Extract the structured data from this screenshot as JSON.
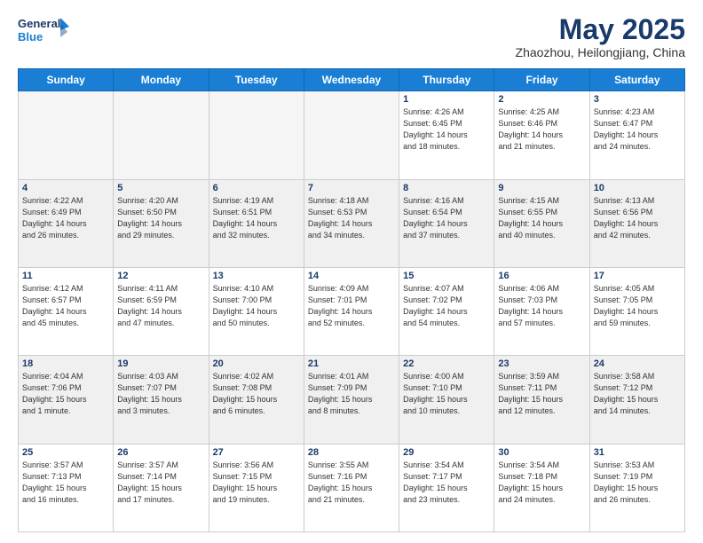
{
  "logo": {
    "line1": "General",
    "line2": "Blue"
  },
  "title": "May 2025",
  "location": "Zhaozhou, Heilongjiang, China",
  "days_of_week": [
    "Sunday",
    "Monday",
    "Tuesday",
    "Wednesday",
    "Thursday",
    "Friday",
    "Saturday"
  ],
  "weeks": [
    [
      {
        "day": "",
        "detail": "",
        "empty": true
      },
      {
        "day": "",
        "detail": "",
        "empty": true
      },
      {
        "day": "",
        "detail": "",
        "empty": true
      },
      {
        "day": "",
        "detail": "",
        "empty": true
      },
      {
        "day": "1",
        "detail": "Sunrise: 4:26 AM\nSunset: 6:45 PM\nDaylight: 14 hours\nand 18 minutes."
      },
      {
        "day": "2",
        "detail": "Sunrise: 4:25 AM\nSunset: 6:46 PM\nDaylight: 14 hours\nand 21 minutes."
      },
      {
        "day": "3",
        "detail": "Sunrise: 4:23 AM\nSunset: 6:47 PM\nDaylight: 14 hours\nand 24 minutes."
      }
    ],
    [
      {
        "day": "4",
        "detail": "Sunrise: 4:22 AM\nSunset: 6:49 PM\nDaylight: 14 hours\nand 26 minutes."
      },
      {
        "day": "5",
        "detail": "Sunrise: 4:20 AM\nSunset: 6:50 PM\nDaylight: 14 hours\nand 29 minutes."
      },
      {
        "day": "6",
        "detail": "Sunrise: 4:19 AM\nSunset: 6:51 PM\nDaylight: 14 hours\nand 32 minutes."
      },
      {
        "day": "7",
        "detail": "Sunrise: 4:18 AM\nSunset: 6:53 PM\nDaylight: 14 hours\nand 34 minutes."
      },
      {
        "day": "8",
        "detail": "Sunrise: 4:16 AM\nSunset: 6:54 PM\nDaylight: 14 hours\nand 37 minutes."
      },
      {
        "day": "9",
        "detail": "Sunrise: 4:15 AM\nSunset: 6:55 PM\nDaylight: 14 hours\nand 40 minutes."
      },
      {
        "day": "10",
        "detail": "Sunrise: 4:13 AM\nSunset: 6:56 PM\nDaylight: 14 hours\nand 42 minutes."
      }
    ],
    [
      {
        "day": "11",
        "detail": "Sunrise: 4:12 AM\nSunset: 6:57 PM\nDaylight: 14 hours\nand 45 minutes."
      },
      {
        "day": "12",
        "detail": "Sunrise: 4:11 AM\nSunset: 6:59 PM\nDaylight: 14 hours\nand 47 minutes."
      },
      {
        "day": "13",
        "detail": "Sunrise: 4:10 AM\nSunset: 7:00 PM\nDaylight: 14 hours\nand 50 minutes."
      },
      {
        "day": "14",
        "detail": "Sunrise: 4:09 AM\nSunset: 7:01 PM\nDaylight: 14 hours\nand 52 minutes."
      },
      {
        "day": "15",
        "detail": "Sunrise: 4:07 AM\nSunset: 7:02 PM\nDaylight: 14 hours\nand 54 minutes."
      },
      {
        "day": "16",
        "detail": "Sunrise: 4:06 AM\nSunset: 7:03 PM\nDaylight: 14 hours\nand 57 minutes."
      },
      {
        "day": "17",
        "detail": "Sunrise: 4:05 AM\nSunset: 7:05 PM\nDaylight: 14 hours\nand 59 minutes."
      }
    ],
    [
      {
        "day": "18",
        "detail": "Sunrise: 4:04 AM\nSunset: 7:06 PM\nDaylight: 15 hours\nand 1 minute."
      },
      {
        "day": "19",
        "detail": "Sunrise: 4:03 AM\nSunset: 7:07 PM\nDaylight: 15 hours\nand 3 minutes."
      },
      {
        "day": "20",
        "detail": "Sunrise: 4:02 AM\nSunset: 7:08 PM\nDaylight: 15 hours\nand 6 minutes."
      },
      {
        "day": "21",
        "detail": "Sunrise: 4:01 AM\nSunset: 7:09 PM\nDaylight: 15 hours\nand 8 minutes."
      },
      {
        "day": "22",
        "detail": "Sunrise: 4:00 AM\nSunset: 7:10 PM\nDaylight: 15 hours\nand 10 minutes."
      },
      {
        "day": "23",
        "detail": "Sunrise: 3:59 AM\nSunset: 7:11 PM\nDaylight: 15 hours\nand 12 minutes."
      },
      {
        "day": "24",
        "detail": "Sunrise: 3:58 AM\nSunset: 7:12 PM\nDaylight: 15 hours\nand 14 minutes."
      }
    ],
    [
      {
        "day": "25",
        "detail": "Sunrise: 3:57 AM\nSunset: 7:13 PM\nDaylight: 15 hours\nand 16 minutes."
      },
      {
        "day": "26",
        "detail": "Sunrise: 3:57 AM\nSunset: 7:14 PM\nDaylight: 15 hours\nand 17 minutes."
      },
      {
        "day": "27",
        "detail": "Sunrise: 3:56 AM\nSunset: 7:15 PM\nDaylight: 15 hours\nand 19 minutes."
      },
      {
        "day": "28",
        "detail": "Sunrise: 3:55 AM\nSunset: 7:16 PM\nDaylight: 15 hours\nand 21 minutes."
      },
      {
        "day": "29",
        "detail": "Sunrise: 3:54 AM\nSunset: 7:17 PM\nDaylight: 15 hours\nand 23 minutes."
      },
      {
        "day": "30",
        "detail": "Sunrise: 3:54 AM\nSunset: 7:18 PM\nDaylight: 15 hours\nand 24 minutes."
      },
      {
        "day": "31",
        "detail": "Sunrise: 3:53 AM\nSunset: 7:19 PM\nDaylight: 15 hours\nand 26 minutes."
      }
    ]
  ],
  "gray_rows": [
    1,
    3
  ]
}
